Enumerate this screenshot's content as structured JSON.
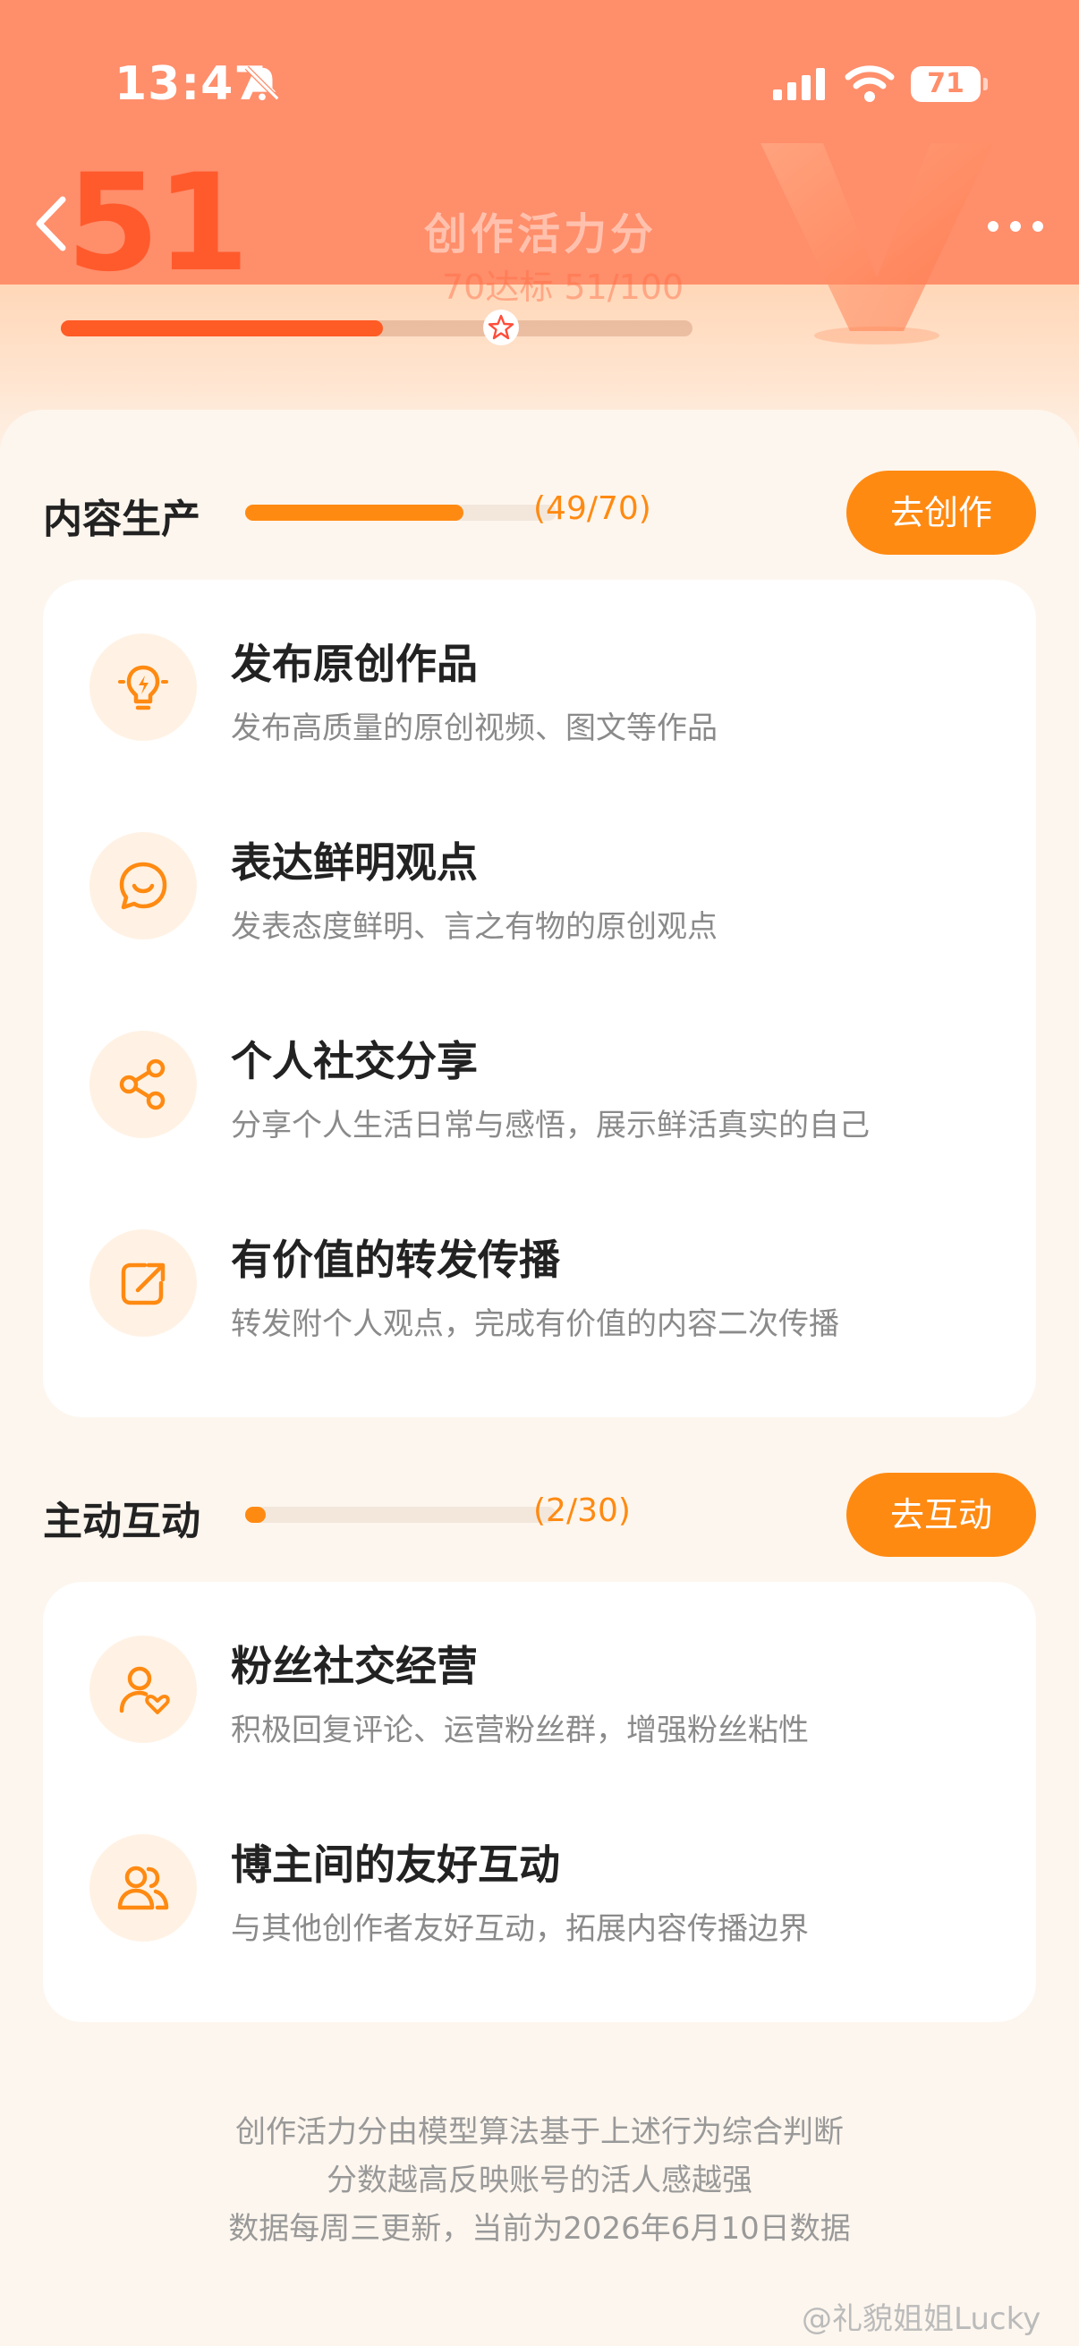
{
  "status_bar": {
    "time": "13:47",
    "battery": "71",
    "icons": [
      "bell-muted-icon",
      "signal-icon",
      "wifi-icon",
      "battery-icon"
    ]
  },
  "header": {
    "score": "51",
    "title": "创作活力分",
    "goal_text": "70达标  51/100",
    "progress": 0.51,
    "colors": {
      "accent": "#ff5a2c",
      "header_bg": "#ff8e6b"
    }
  },
  "sections": [
    {
      "title": "内容生产",
      "count": "(49/70)",
      "progress": 0.7,
      "button": "去创作",
      "items": [
        {
          "icon": "lightbulb-icon",
          "title": "发布原创作品",
          "desc": "发布高质量的原创视频、图文等作品"
        },
        {
          "icon": "chat-smile-icon",
          "title": "表达鲜明观点",
          "desc": "发表态度鲜明、言之有物的原创观点"
        },
        {
          "icon": "share-icon",
          "title": "个人社交分享",
          "desc": "分享个人生活日常与感悟，展示鲜活真实的自己"
        },
        {
          "icon": "forward-icon",
          "title": "有价值的转发传播",
          "desc": "转发附个人观点，完成有价值的内容二次传播"
        }
      ]
    },
    {
      "title": "主动互动",
      "count": "(2/30)",
      "progress": 0.067,
      "button": "去互动",
      "items": [
        {
          "icon": "user-heart-icon",
          "title": "粉丝社交经营",
          "desc": "积极回复评论、运营粉丝群，增强粉丝粘性"
        },
        {
          "icon": "users-icon",
          "title": "博主间的友好互动",
          "desc": "与其他创作者友好互动，拓展内容传播边界"
        }
      ]
    }
  ],
  "footer": {
    "lines": [
      "创作活力分由模型算法基于上述行为综合判断",
      "分数越高反映账号的活人感越强",
      "数据每周三更新，当前为2026年6月10日数据"
    ]
  },
  "watermark": "@礼貌姐姐Lucky",
  "colors": {
    "orange": "#ff8a12",
    "icon_bg": "#fff2e4"
  }
}
